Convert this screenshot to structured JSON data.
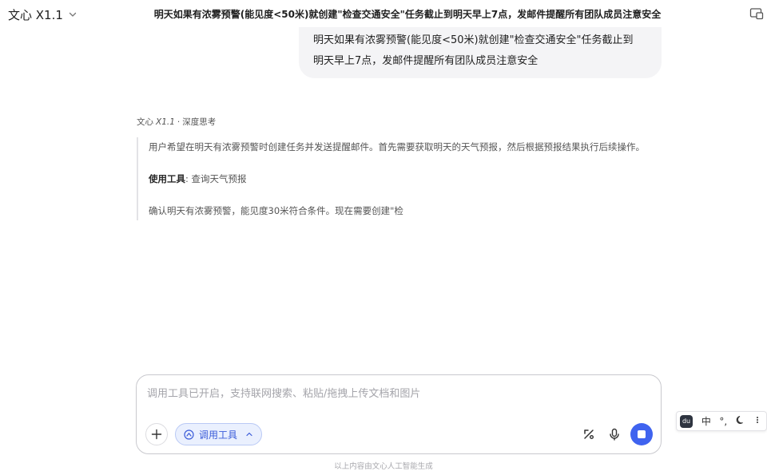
{
  "header": {
    "model_name": "文心 X1.1",
    "conversation_title": "明天如果有浓雾预警(能见度<50米)就创建\"检查交通安全\"任务截止到明天早上7点，发邮件提醒所有团队成员注意安全"
  },
  "user_message": {
    "line1": "明天如果有浓雾预警(能见度<50米)就创建\"检查交通安全\"任务截止到",
    "line2": "明天早上7点，发邮件提醒所有团队成员注意安全"
  },
  "assistant": {
    "name": "文心",
    "version": "X1.1",
    "separator": "·",
    "mode": "深度思考",
    "thinking": {
      "paragraph1": "用户希望在明天有浓雾预警时创建任务并发送提醒邮件。首先需要获取明天的天气预报，然后根据预报结果执行后续操作。",
      "tool_label": "使用工具",
      "tool_sep": ": ",
      "tool_name": "查询天气预报",
      "paragraph3": "确认明天有浓雾预警，能见度30米符合条件。现在需要创建\"检"
    }
  },
  "input": {
    "placeholder": "调用工具已开启，支持联网搜索、粘贴/拖拽上传文档和图片",
    "value": "",
    "tool_toggle_label": "调用工具"
  },
  "footer": {
    "note": "以上内容由文心人工智能生成"
  },
  "ime": {
    "lang": "中",
    "punct": "°,",
    "logo_text": "du"
  },
  "icons": {
    "model_dropdown": "chevron-down-icon",
    "window": "window-icon",
    "attach": "plus-icon",
    "tool": "tool-icon",
    "tool_expand": "chevron-up-icon",
    "disable_tools": "slash-percent-icon",
    "voice": "microphone-icon",
    "stop": "stop-icon",
    "moon": "moon-icon"
  },
  "colors": {
    "accent": "#3f63ef",
    "pill_bg": "#eaf0fe",
    "pill_text": "#3b5cd9",
    "bubble_bg": "#f4f4f6"
  }
}
